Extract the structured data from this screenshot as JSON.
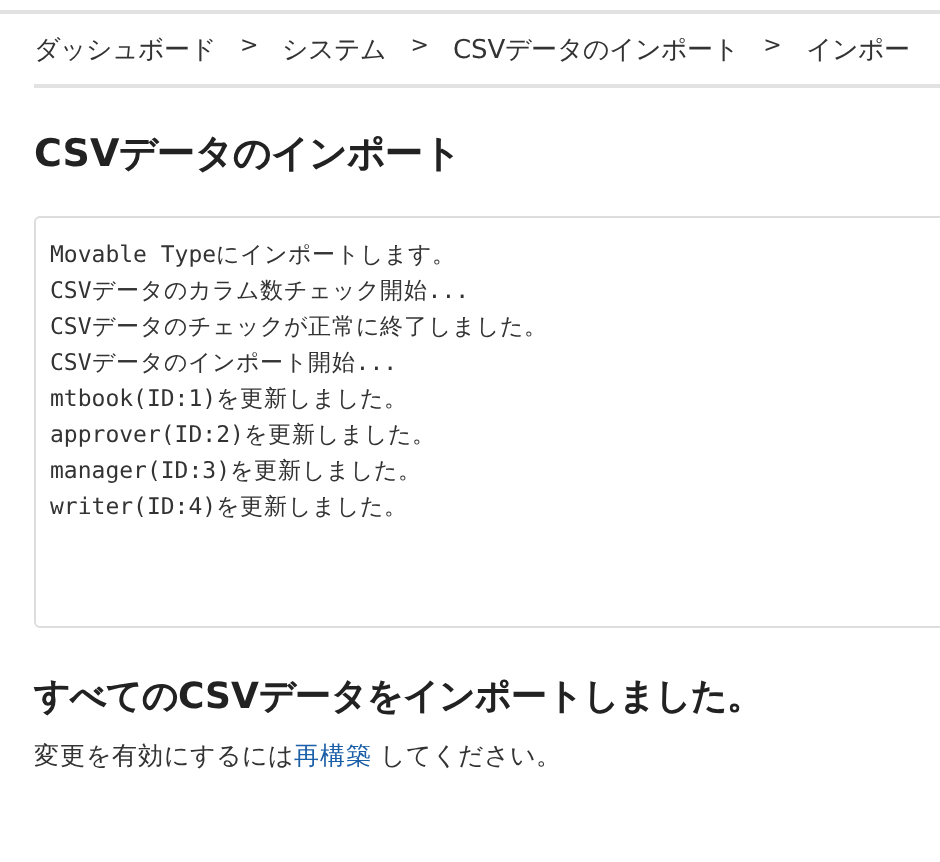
{
  "breadcrumb": [
    "ダッシュボード",
    "システム",
    "CSVデータのインポート",
    "インポー"
  ],
  "breadcrumb_separator": ">",
  "title": "CSVデータのインポート",
  "log": [
    "Movable Typeにインポートします。",
    "CSVデータのカラム数チェック開始...",
    "CSVデータのチェックが正常に終了しました。",
    "CSVデータのインポート開始...",
    "mtbook(ID:1)を更新しました。",
    "approver(ID:2)を更新しました。",
    "manager(ID:3)を更新しました。",
    "writer(ID:4)を更新しました。"
  ],
  "result_heading": "すべてのCSVデータをインポートしました。",
  "message": {
    "before": "変更を有効にするには",
    "link": "再構築",
    "after": " してください。"
  }
}
